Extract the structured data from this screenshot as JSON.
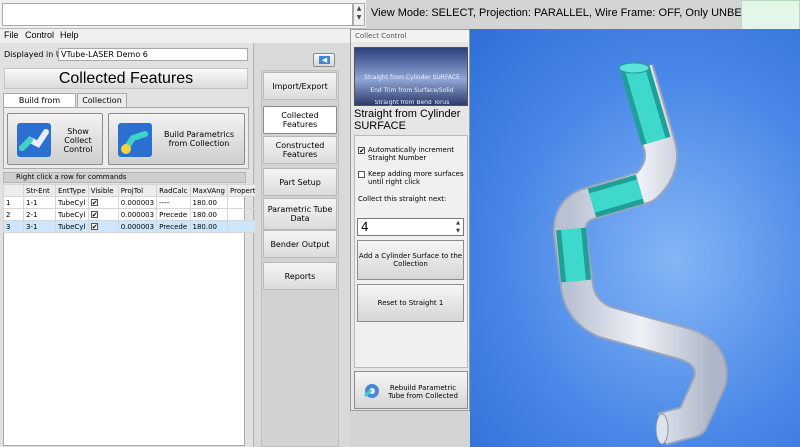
{
  "top": {
    "input_value": "",
    "view_mode": "View Mode: SELECT, Projection: PARALLEL, Wire Frame: OFF, Only UNBENT Tube: OFF,"
  },
  "menu": [
    "File",
    "Control",
    "Help"
  ],
  "left": {
    "displayed_label": "Displayed in UI:",
    "displayed_value": "VTube-LASER Demo 6",
    "title": "Collected Features",
    "tabs": [
      "Build from Collection",
      "Collection List"
    ],
    "btn_show": "Show Collect Control",
    "btn_build": "Build Parametrics from Collection",
    "hint": "Right click a row for commands",
    "columns": [
      "",
      "Str-Ent",
      "EntType",
      "Visible",
      "ProjTol",
      "RadCalc",
      "MaxVAng",
      "Propertie"
    ],
    "rows": [
      [
        "1",
        "1-1",
        "TubeCyl",
        "✔",
        "0.000003",
        "----",
        "180.00",
        ""
      ],
      [
        "2",
        "2-1",
        "TubeCyl",
        "✔",
        "0.000003",
        "Precede",
        "180.00",
        ""
      ],
      [
        "3",
        "3-1",
        "TubeCyl",
        "✔",
        "0.000003",
        "Precede",
        "180.00",
        ""
      ]
    ],
    "selected_row": 3
  },
  "nav": {
    "items": [
      "Import/Export",
      "Collected Features",
      "Constructed Features",
      "Part Setup",
      "Parametric Tube Data",
      "Bender Output",
      "Reports"
    ],
    "active": "Collected Features"
  },
  "dialog": {
    "title": "Collect Control",
    "banner_lines": [
      "Straight from Cylinder SURFACE",
      "End  Trim from Surface/Solid",
      "Straight from Bend Torus"
    ],
    "heading": "Straight from Cylinder SURFACE",
    "cb_auto": "Automatically increment Straight Number",
    "cb_auto_checked": true,
    "cb_keep": "Keep adding more surfaces until right click",
    "cb_keep_checked": false,
    "next_label": "Collect this straight next:",
    "next_value": "4",
    "btn_add": "Add a Cylinder Surface to the Collection",
    "btn_reset": "Reset to Straight 1",
    "btn_rebuild": "Rebuild Parametric Tube from Collected"
  },
  "colors": {
    "viewport_blue": "#4a89e8",
    "tube_teal": "#34cfc4",
    "tube_gray": "#d8dde6",
    "nav_arrow": "#3f86d8"
  }
}
